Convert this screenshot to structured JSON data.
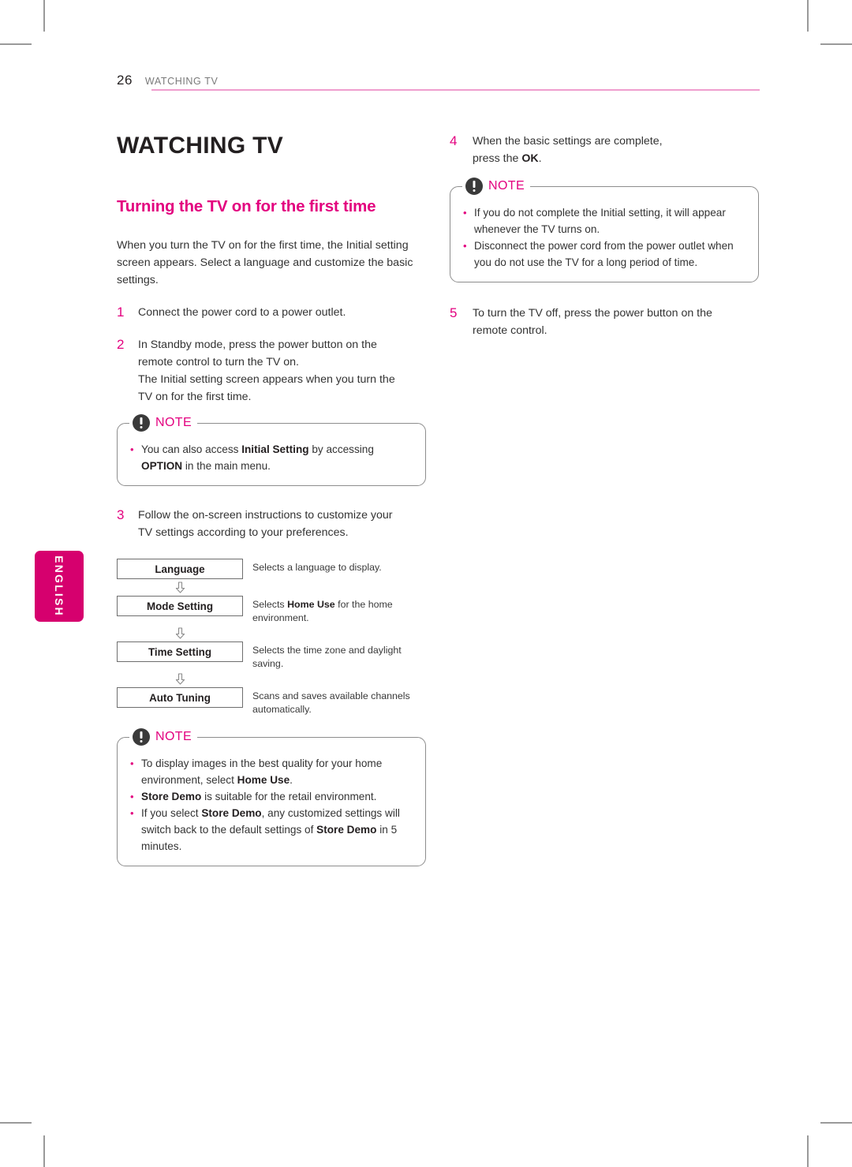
{
  "colors": {
    "accent_magenta": "#e3007f",
    "tab_magenta": "#d6006e",
    "rule_pink": "#ef9ece",
    "text": "#231f20",
    "note_border": "#8d8d8d"
  },
  "running_head": {
    "page_number": "26",
    "chapter": "WATCHING TV"
  },
  "side_tab": {
    "label": "ENGLISH"
  },
  "left_column": {
    "page_title": "WATCHING TV",
    "section_title": "Turning the TV on for the first time",
    "intro": "When you turn the TV on for the first time, the Initial setting screen appears. Select a language and customize the basic settings.",
    "steps": [
      {
        "number": "1",
        "lines": [
          "Connect the power cord to a power outlet."
        ]
      },
      {
        "number": "2",
        "lines": [
          "In Standby mode, press the power button on the",
          "remote control to turn the TV on.",
          "The Initial setting screen appears when you turn the",
          "TV on for the first time."
        ]
      }
    ],
    "note_1": {
      "label": "NOTE",
      "icon": "exclamation-circle-icon",
      "items": [
        {
          "segments": [
            {
              "text": "You can also access ",
              "bold": false
            },
            {
              "text": "Initial Setting",
              "bold": true
            },
            {
              "text": " by accessing ",
              "bold": false
            },
            {
              "text": "OPTION",
              "bold": true
            },
            {
              "text": " in the main menu.",
              "bold": false
            }
          ]
        }
      ]
    },
    "step_3": {
      "number": "3",
      "lines": [
        "Follow the on-screen instructions to customize your",
        "TV settings according to your preferences."
      ]
    },
    "flow": {
      "arrow_icon": "arrow-down-outline-icon",
      "rows": [
        {
          "box": "Language",
          "desc_segments": [
            {
              "text": "Selects a language to display.",
              "bold": false
            }
          ]
        },
        {
          "box": "Mode Setting",
          "desc_segments": [
            {
              "text": "Selects ",
              "bold": false
            },
            {
              "text": "Home Use",
              "bold": true
            },
            {
              "text": " for the home environment.",
              "bold": false
            }
          ]
        },
        {
          "box": "Time Setting",
          "desc_segments": [
            {
              "text": "Selects the time zone and daylight saving.",
              "bold": false
            }
          ]
        },
        {
          "box": "Auto Tuning",
          "desc_segments": [
            {
              "text": "Scans and saves available channels automatically.",
              "bold": false
            }
          ]
        }
      ]
    },
    "note_2": {
      "label": "NOTE",
      "icon": "exclamation-circle-icon",
      "items": [
        {
          "segments": [
            {
              "text": "To display images in the best quality for your home environment, select ",
              "bold": false
            },
            {
              "text": "Home Use",
              "bold": true
            },
            {
              "text": ".",
              "bold": false
            }
          ]
        },
        {
          "segments": [
            {
              "text": "Store Demo",
              "bold": true
            },
            {
              "text": " is suitable for the retail environment.",
              "bold": false
            }
          ]
        },
        {
          "segments": [
            {
              "text": "If you select ",
              "bold": false
            },
            {
              "text": "Store Demo",
              "bold": true
            },
            {
              "text": ", any customized settings will switch back to the default settings of ",
              "bold": false
            },
            {
              "text": "Store Demo",
              "bold": true
            },
            {
              "text": " in 5 minutes.",
              "bold": false
            }
          ]
        }
      ]
    }
  },
  "right_column": {
    "step_4": {
      "number": "4",
      "line_segments": [
        [
          {
            "text": "When the basic settings are complete,",
            "bold": false
          }
        ],
        [
          {
            "text": "press the ",
            "bold": false
          },
          {
            "text": "OK",
            "bold": true
          },
          {
            "text": ".",
            "bold": false
          }
        ]
      ]
    },
    "note_3": {
      "label": "NOTE",
      "icon": "exclamation-circle-icon",
      "items": [
        {
          "segments": [
            {
              "text": "If you do not complete the Initial setting, it will appear whenever the TV turns on.",
              "bold": false
            }
          ]
        },
        {
          "segments": [
            {
              "text": "Disconnect the power cord from the power outlet when you do not use the TV for a long period of time.",
              "bold": false
            }
          ]
        }
      ]
    },
    "step_5": {
      "number": "5",
      "lines": [
        "To turn the TV off, press the power button on the",
        "remote control."
      ]
    }
  }
}
